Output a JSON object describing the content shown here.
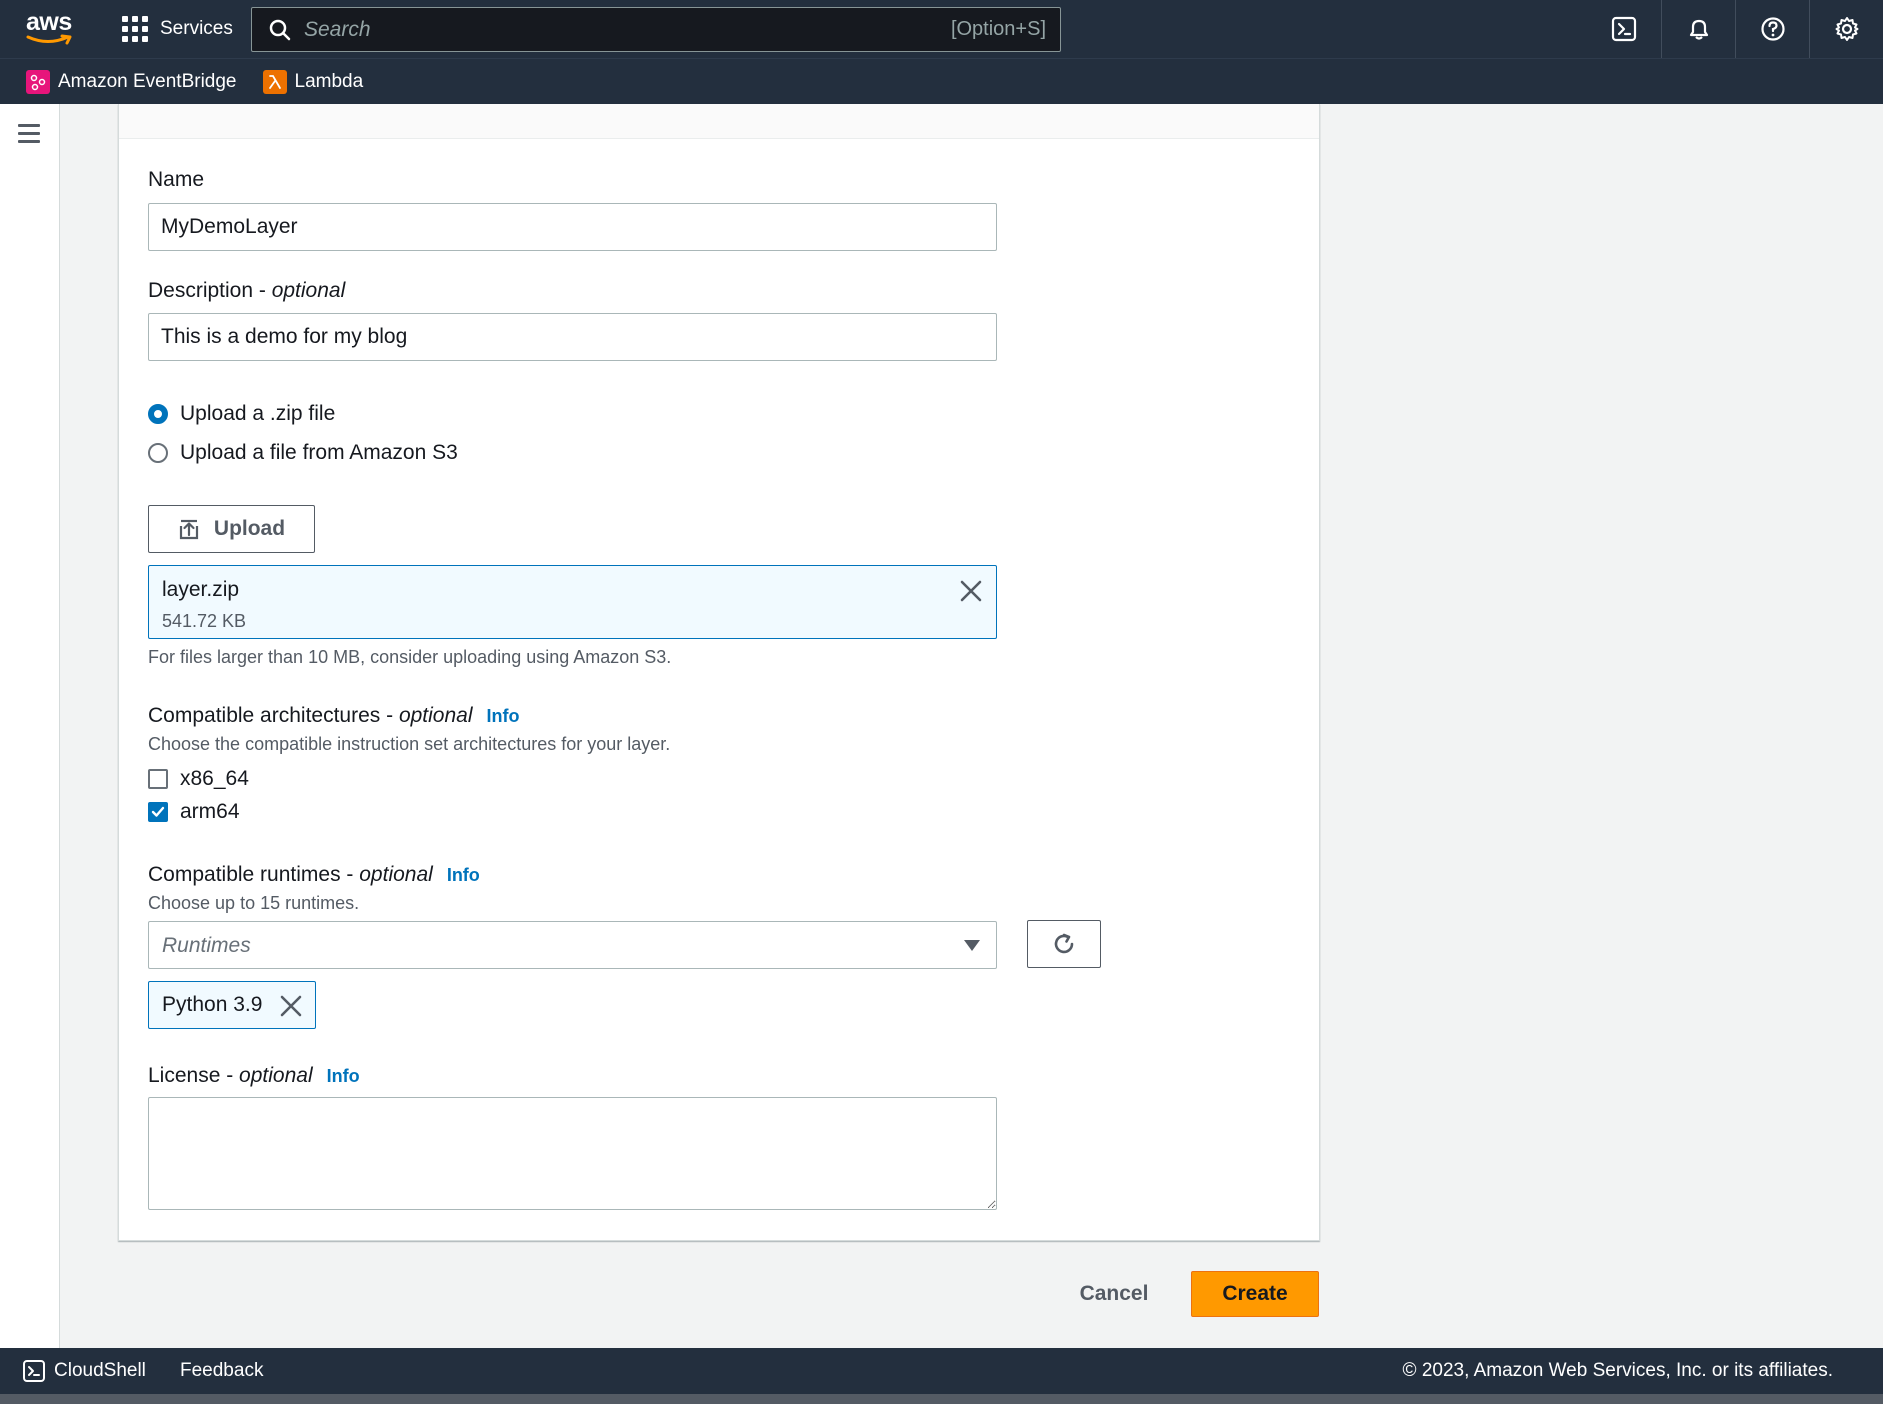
{
  "nav": {
    "logo_text": "aws",
    "services_label": "Services",
    "search_placeholder": "Search",
    "search_shortcut": "[Option+S]"
  },
  "favorites": [
    {
      "label": "Amazon EventBridge",
      "color": "#e7157b"
    },
    {
      "label": "Lambda",
      "color": "#ed7100"
    }
  ],
  "form": {
    "name_label": "Name",
    "name_value": "MyDemoLayer",
    "description_label": "Description - ",
    "description_optional": "optional",
    "description_value": "This is a demo for my blog",
    "upload_zip_label": "Upload a .zip file",
    "upload_s3_label": "Upload a file from Amazon S3",
    "upload_button": "Upload",
    "file_name": "layer.zip",
    "file_size": "541.72 KB",
    "file_hint": "For files larger than 10 MB, consider uploading using Amazon S3.",
    "arch_label": "Compatible architectures - ",
    "arch_optional": "optional",
    "arch_info": "Info",
    "arch_hint": "Choose the compatible instruction set architectures for your layer.",
    "arch_options": [
      {
        "label": "x86_64",
        "checked": false
      },
      {
        "label": "arm64",
        "checked": true
      }
    ],
    "runtimes_label": "Compatible runtimes - ",
    "runtimes_optional": "optional",
    "runtimes_info": "Info",
    "runtimes_hint": "Choose up to 15 runtimes.",
    "runtimes_placeholder": "Runtimes",
    "selected_runtime": "Python 3.9",
    "license_label": "License - ",
    "license_optional": "optional",
    "license_info": "Info",
    "license_value": ""
  },
  "actions": {
    "cancel": "Cancel",
    "create": "Create"
  },
  "footer": {
    "cloudshell": "CloudShell",
    "feedback": "Feedback",
    "copyright": "© 2023, Amazon Web Services, Inc. or its affiliates."
  },
  "colors": {
    "nav_bg": "#232f3e",
    "accent_blue": "#0073bb",
    "create_orange": "#ff9900"
  }
}
